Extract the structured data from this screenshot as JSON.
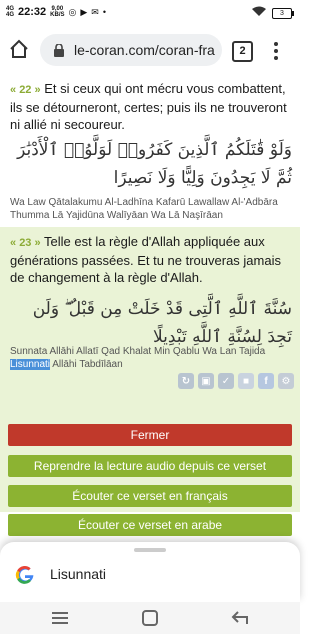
{
  "status": {
    "signal": "4G",
    "signal2": "4G",
    "time": "22:32",
    "speed_value": "9,00",
    "speed_unit": "KB/S",
    "battery": "3"
  },
  "browser": {
    "url": "le-coran.com/coran-fra",
    "tab_count": "2"
  },
  "verse22": {
    "number": "22",
    "text": "Et si ceux qui ont mécru vous combattent, ils se détourneront, certes; puis ils ne trouveront ni allié ni secoureur.",
    "arabic": "وَلَوْ قَٰتَلَكُمُ ٱلَّذِينَ كَفَرُوا۟ لَوَلَّوُا۟ ٱلْأَدْبَٰرَ ثُمَّ لَا يَجِدُونَ وَلِيًّا وَلَا نَصِيرًا",
    "translit": "Wa Law Qātalakumu Al-Ladhīna Kafarū Lawallaw Al-'Adbāra Thumma Lā Yajidūna Walīyāan Wa Lā Naşīrāan"
  },
  "verse23": {
    "number": "23",
    "text": "Telle est la règle d'Allah appliquée aux générations passées. Et tu ne trouveras jamais de changement à la règle d'Allah.",
    "arabic": "سُنَّةَ ٱللَّهِ ٱلَّتِى قَدْ خَلَتْ مِن قَبْلُ ۖ وَلَن تَجِدَ لِسُنَّةِ ٱللَّهِ تَبْدِيلًا",
    "translit_before": "Sunnata Allāhi Allatī Qad Khalat Min Qablu Wa Lan Tajida ",
    "translit_selected": "Lisunnati",
    "translit_after": " Allāhi Tabdīlāan"
  },
  "buttons": {
    "close": "Fermer",
    "resume_audio": "Reprendre la lecture audio depuis ce verset",
    "listen_fr": "Écouter ce verset en français",
    "listen_ar": "Écouter ce verset en arabe"
  },
  "sheet": {
    "search_text": "Lisunnati"
  },
  "colors": {
    "accent_green": "#8cb332",
    "close_red": "#c0392b",
    "verse_bg": "#eaf3d6"
  }
}
